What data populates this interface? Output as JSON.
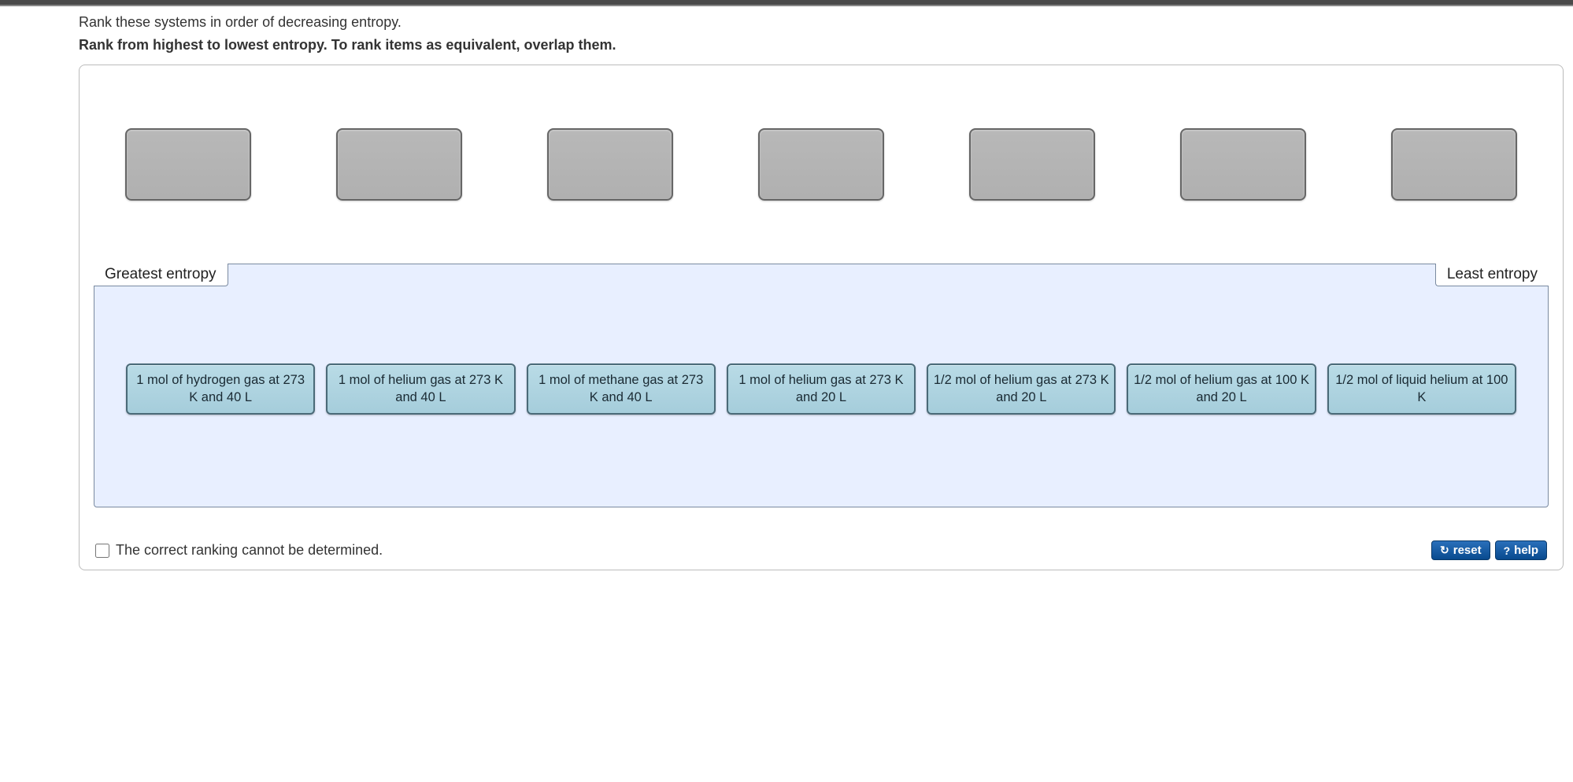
{
  "instructions": {
    "line1": "Rank these systems in order of decreasing entropy.",
    "line2": "Rank from highest to lowest entropy. To rank items as equivalent, overlap them."
  },
  "rank": {
    "left_label": "Greatest entropy",
    "right_label": "Least entropy"
  },
  "items": [
    "1 mol of hydrogen gas at 273 K and 40 L",
    "1 mol of helium gas at 273 K and 40 L",
    "1 mol of methane gas at 273 K and 40 L",
    "1 mol of helium gas at 273 K and 20 L",
    "1/2 mol of helium gas at 273 K and 20 L",
    "1/2 mol of helium gas at 100 K and 20 L",
    "1/2 mol of liquid helium at 100 K"
  ],
  "footer": {
    "checkbox_label": "The correct ranking cannot be determined.",
    "reset_label": "reset",
    "help_label": "help"
  }
}
